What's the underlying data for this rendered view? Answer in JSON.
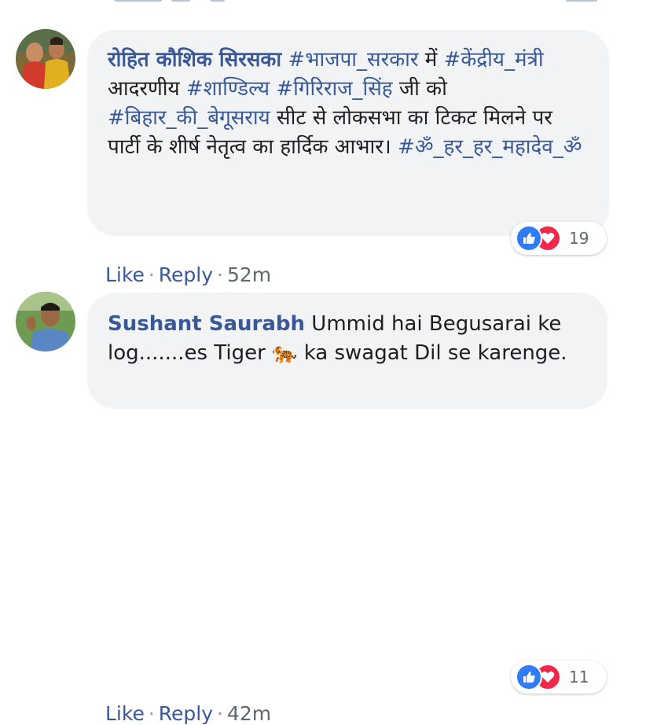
{
  "comments": [
    {
      "author": "रोहित कौशिक सिरसका",
      "segments": [
        {
          "text": " ",
          "tag": false
        },
        {
          "text": "#भाजपा_सरकार",
          "tag": true
        },
        {
          "text": " में ",
          "tag": false
        },
        {
          "text": "#केंद्रीय_मंत्री",
          "tag": true
        },
        {
          "text": " आदरणीय ",
          "tag": false
        },
        {
          "text": "#शाण्डिल्य",
          "tag": true
        },
        {
          "text": " ",
          "tag": false
        },
        {
          "text": "#गिरिराज_सिंह",
          "tag": true
        },
        {
          "text": " जी को ",
          "tag": false
        },
        {
          "text": "#बिहार_की_बेगूसराय",
          "tag": true
        },
        {
          "text": " सीट से लोकसभा का टिकट मिलने पर पार्टी के शीर्ष नेतृत्व का हार्दिक आभार। ",
          "tag": false
        },
        {
          "text": "#ॐ_हर_हर_महादेव_ॐ",
          "tag": true
        }
      ],
      "reactions": {
        "icons": [
          "like-icon",
          "love-icon"
        ],
        "count": "19"
      },
      "actions": {
        "like": "Like",
        "reply": "Reply",
        "separator": "·",
        "time": "52m"
      }
    },
    {
      "author": "Sushant Saurabh",
      "text_before": " Ummid hai Begusarai ke log.......es Tiger ",
      "emoji": "🐅",
      "text_after": " ka swagat Dil se karenge.",
      "reactions": {
        "icons": [
          "like-icon",
          "love-icon"
        ],
        "count": "11"
      },
      "actions": {
        "like": "Like",
        "reply": "Reply",
        "separator": "·",
        "time": "42m"
      }
    }
  ],
  "colors": {
    "link": "#385898",
    "bubble": "#f2f3f5",
    "like": "#2e7cf6",
    "love": "#f0284a"
  }
}
